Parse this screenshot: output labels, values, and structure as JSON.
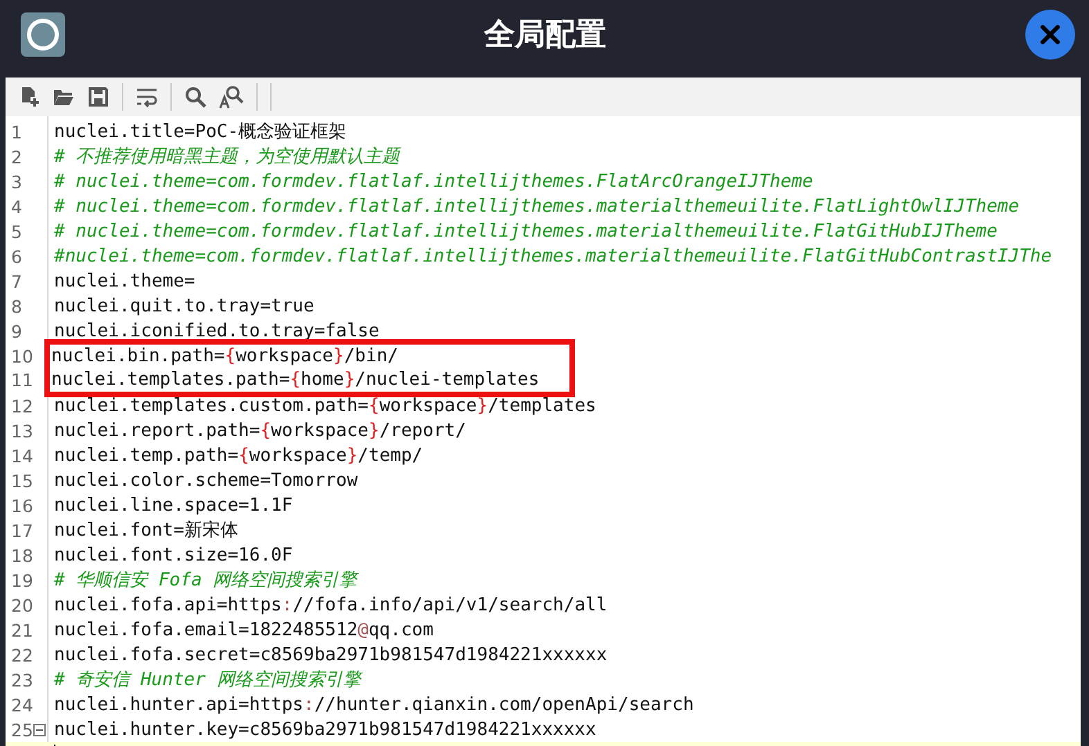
{
  "window": {
    "title": "全局配置"
  },
  "toolbar": [
    {
      "kind": "new-file"
    },
    {
      "kind": "open"
    },
    {
      "kind": "save"
    },
    {
      "kind": "separator"
    },
    {
      "kind": "wrap"
    },
    {
      "kind": "separator"
    },
    {
      "kind": "find"
    },
    {
      "kind": "replace"
    },
    {
      "kind": "separator"
    },
    {
      "kind": "separator"
    }
  ],
  "editor": {
    "lines": [
      {
        "number": "1",
        "segments": [
          {
            "kind": "plain",
            "text": "nuclei.title=PoC-概念验证框架"
          }
        ]
      },
      {
        "number": "2",
        "segments": [
          {
            "kind": "comment",
            "text": "# 不推荐使用暗黑主题，为空使用默认主题"
          }
        ]
      },
      {
        "number": "3",
        "segments": [
          {
            "kind": "comment",
            "text": "# nuclei.theme=com.formdev.flatlaf.intellijthemes.FlatArcOrangeIJTheme"
          }
        ]
      },
      {
        "number": "4",
        "segments": [
          {
            "kind": "comment",
            "text": "# nuclei.theme=com.formdev.flatlaf.intellijthemes.materialthemeuilite.FlatLightOwlIJTheme"
          }
        ]
      },
      {
        "number": "5",
        "segments": [
          {
            "kind": "comment",
            "text": "# nuclei.theme=com.formdev.flatlaf.intellijthemes.materialthemeuilite.FlatGitHubIJTheme"
          }
        ]
      },
      {
        "number": "6",
        "segments": [
          {
            "kind": "comment",
            "text": "#nuclei.theme=com.formdev.flatlaf.intellijthemes.materialthemeuilite.FlatGitHubContrastIJThe"
          }
        ]
      },
      {
        "number": "7",
        "segments": [
          {
            "kind": "plain",
            "text": "nuclei.theme="
          }
        ]
      },
      {
        "number": "8",
        "segments": [
          {
            "kind": "plain",
            "text": "nuclei.quit.to.tray=true"
          }
        ]
      },
      {
        "number": "9",
        "segments": [
          {
            "kind": "plain",
            "text": "nuclei.iconified.to.tray=false"
          }
        ]
      },
      {
        "number": "10",
        "boxed": true,
        "segments": [
          {
            "kind": "plain",
            "text": "nuclei.bin.path="
          },
          {
            "kind": "brace",
            "text": "{"
          },
          {
            "kind": "plain",
            "text": "workspace"
          },
          {
            "kind": "brace",
            "text": "}"
          },
          {
            "kind": "plain",
            "text": "/bin/"
          }
        ]
      },
      {
        "number": "11",
        "boxed": true,
        "segments": [
          {
            "kind": "plain",
            "text": "nuclei.templates.path="
          },
          {
            "kind": "brace",
            "text": "{"
          },
          {
            "kind": "plain",
            "text": "home"
          },
          {
            "kind": "brace",
            "text": "}"
          },
          {
            "kind": "plain",
            "text": "/nuclei-templates"
          }
        ]
      },
      {
        "number": "12",
        "segments": [
          {
            "kind": "plain",
            "text": "nuclei.templates.custom.path="
          },
          {
            "kind": "brace",
            "text": "{"
          },
          {
            "kind": "plain",
            "text": "workspace"
          },
          {
            "kind": "brace",
            "text": "}"
          },
          {
            "kind": "plain",
            "text": "/templates"
          }
        ]
      },
      {
        "number": "13",
        "segments": [
          {
            "kind": "plain",
            "text": "nuclei.report.path="
          },
          {
            "kind": "brace",
            "text": "{"
          },
          {
            "kind": "plain",
            "text": "workspace"
          },
          {
            "kind": "brace",
            "text": "}"
          },
          {
            "kind": "plain",
            "text": "/report/"
          }
        ]
      },
      {
        "number": "14",
        "segments": [
          {
            "kind": "plain",
            "text": "nuclei.temp.path="
          },
          {
            "kind": "brace",
            "text": "{"
          },
          {
            "kind": "plain",
            "text": "workspace"
          },
          {
            "kind": "brace",
            "text": "}"
          },
          {
            "kind": "plain",
            "text": "/temp/"
          }
        ]
      },
      {
        "number": "15",
        "segments": [
          {
            "kind": "plain",
            "text": "nuclei.color.scheme=Tomorrow"
          }
        ]
      },
      {
        "number": "16",
        "segments": [
          {
            "kind": "plain",
            "text": "nuclei.line.space=1.1F"
          }
        ]
      },
      {
        "number": "17",
        "segments": [
          {
            "kind": "plain",
            "text": "nuclei.font=新宋体"
          }
        ]
      },
      {
        "number": "18",
        "segments": [
          {
            "kind": "plain",
            "text": "nuclei.font.size=16.0F"
          }
        ]
      },
      {
        "number": "19",
        "segments": [
          {
            "kind": "comment",
            "text": "# 华顺信安 Fofa 网络空间搜索引擎"
          }
        ]
      },
      {
        "number": "20",
        "segments": [
          {
            "kind": "plain",
            "text": "nuclei.fofa.api=https"
          },
          {
            "kind": "symbol",
            "text": ":"
          },
          {
            "kind": "plain",
            "text": "//fofa.info/api/v1/search/all"
          }
        ]
      },
      {
        "number": "21",
        "segments": [
          {
            "kind": "plain",
            "text": "nuclei.fofa.email=1822485512"
          },
          {
            "kind": "symbol",
            "text": "@"
          },
          {
            "kind": "plain",
            "text": "qq.com"
          }
        ]
      },
      {
        "number": "22",
        "segments": [
          {
            "kind": "plain",
            "text": "nuclei.fofa.secret=c8569ba2971b981547d1984221xxxxxx"
          }
        ]
      },
      {
        "number": "23",
        "segments": [
          {
            "kind": "comment",
            "text": "# 奇安信 Hunter 网络空间搜索引擎"
          }
        ]
      },
      {
        "number": "24",
        "segments": [
          {
            "kind": "plain",
            "text": "nuclei.hunter.api=https"
          },
          {
            "kind": "symbol",
            "text": ":"
          },
          {
            "kind": "plain",
            "text": "//hunter.qianxin.com/openApi/search"
          }
        ]
      },
      {
        "number": "25",
        "foldable": true,
        "segments": [
          {
            "kind": "plain",
            "text": "nuclei.hunter.key=c8569ba2971b981547d1984221xxxxxx"
          }
        ]
      },
      {
        "current": true
      }
    ]
  }
}
